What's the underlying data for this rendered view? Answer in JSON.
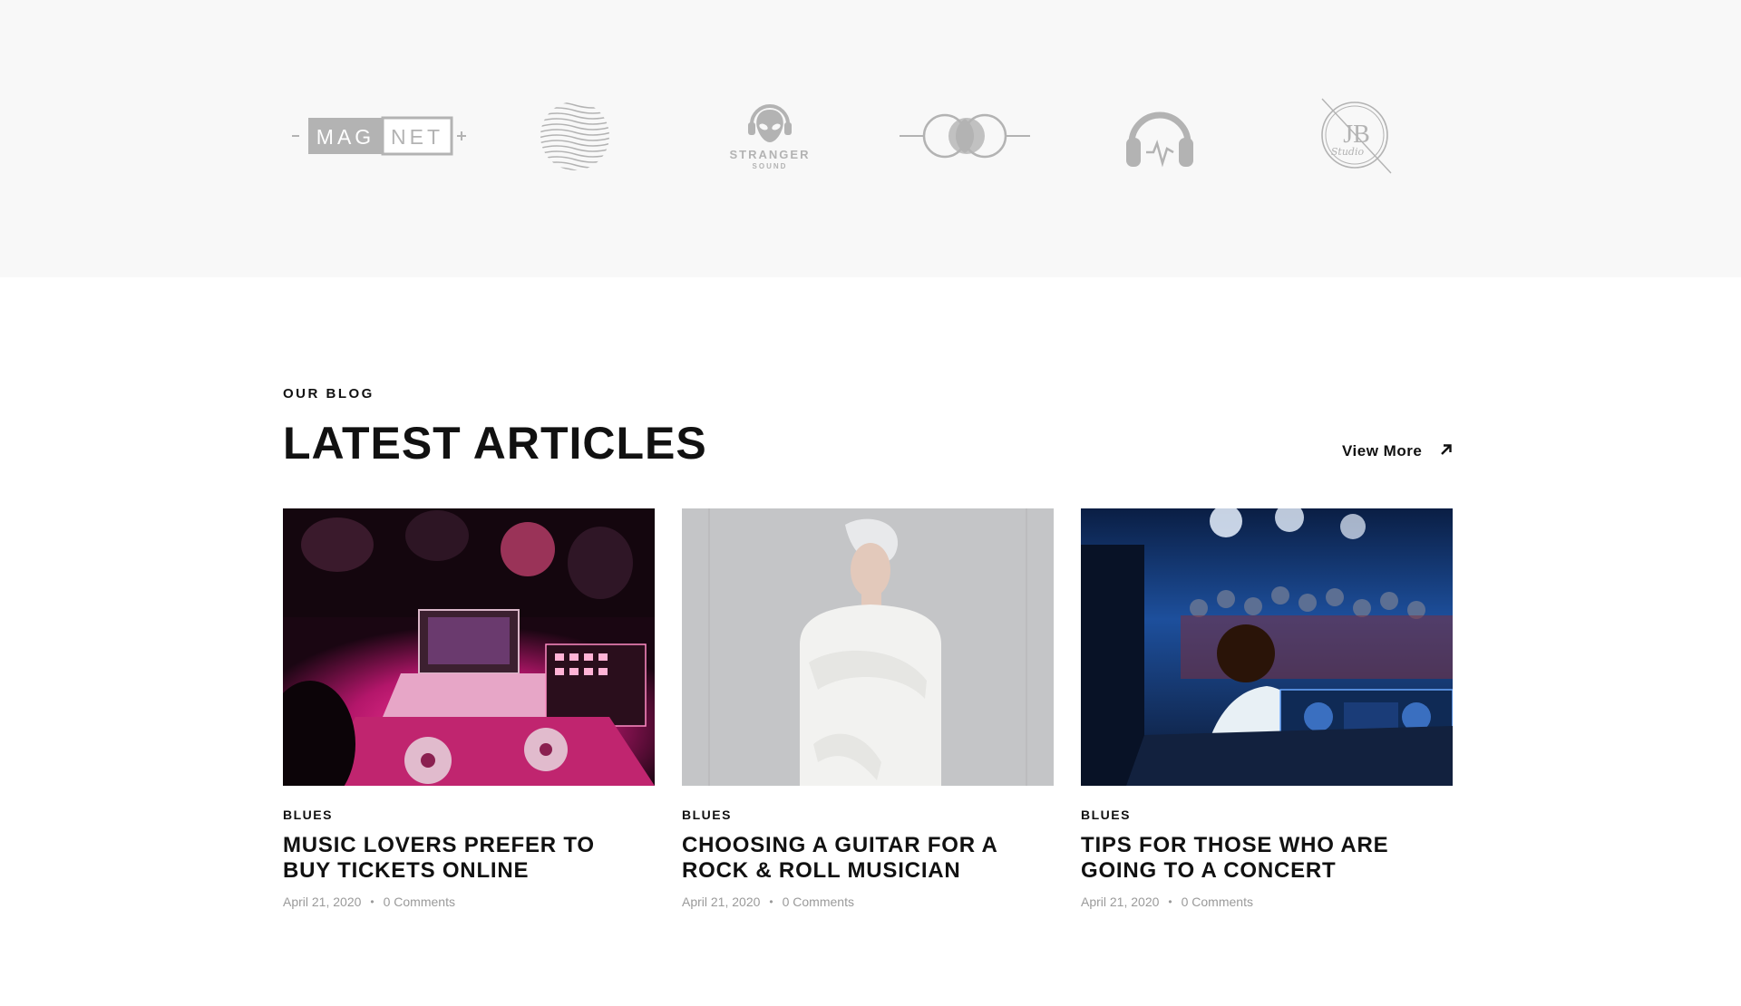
{
  "partners": {
    "logos": [
      {
        "name": "magnet-logo",
        "text_left": "MAG",
        "text_right": "NET"
      },
      {
        "name": "wave-circle-logo"
      },
      {
        "name": "stranger-sound-logo",
        "text": "STRANGER",
        "subtext": "SOUND"
      },
      {
        "name": "circles-logo"
      },
      {
        "name": "headphones-logo"
      },
      {
        "name": "jb-studio-logo",
        "text": "JB",
        "subtext": "Studio"
      }
    ],
    "logo_color": "#b3b3b3"
  },
  "blog": {
    "eyebrow": "OUR BLOG",
    "title": "LATEST ARTICLES",
    "view_more": "View More",
    "articles": [
      {
        "category": "BLUES",
        "title": "MUSIC LOVERS PREFER TO BUY TICKETS ONLINE",
        "date": "April 21, 2020",
        "comments": "0 Comments",
        "image": "dj-controller-pink"
      },
      {
        "category": "BLUES",
        "title": "CHOOSING A GUITAR FOR A ROCK & ROLL MUSICIAN",
        "date": "April 21, 2020",
        "comments": "0 Comments",
        "image": "white-sweater-man"
      },
      {
        "category": "BLUES",
        "title": "TIPS FOR THOSE WHO ARE GOING TO A CONCERT",
        "date": "April 21, 2020",
        "comments": "0 Comments",
        "image": "dj-crowd-blue"
      }
    ]
  },
  "colors": {
    "partners_bg": "#f8f8f8",
    "text": "#111111",
    "meta": "#9a9a9a"
  }
}
